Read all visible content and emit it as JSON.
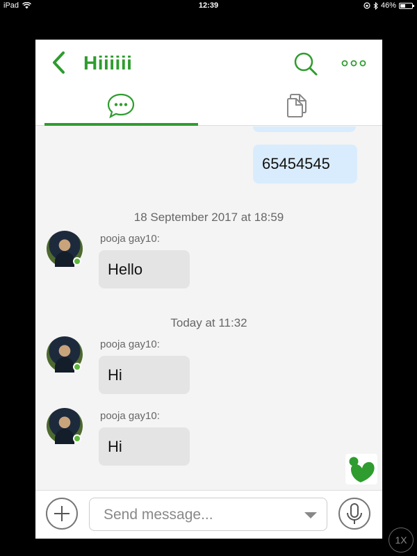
{
  "status_bar": {
    "device": "iPad",
    "time": "12:39",
    "battery": "46%",
    "battery_level": 0.46
  },
  "header": {
    "title": "Hiiiiii"
  },
  "tabs": [
    {
      "icon": "chat-bubble-icon",
      "active": true
    },
    {
      "icon": "copy-icon",
      "active": false
    }
  ],
  "messages": {
    "outgoing": [
      {
        "text": ""
      },
      {
        "text": "65454545"
      }
    ],
    "separators": [
      {
        "text": "18 September 2017 at 18:59"
      },
      {
        "text": "Today at 11:32"
      }
    ],
    "incoming": [
      {
        "sender": "pooja gay10:",
        "text": "Hello"
      },
      {
        "sender": "pooja gay10:",
        "text": "Hi"
      },
      {
        "sender": "pooja gay10:",
        "text": "Hi"
      }
    ]
  },
  "composer": {
    "placeholder": "Send message..."
  },
  "zoom": {
    "label": "1X"
  },
  "colors": {
    "accent": "#2e9c2e",
    "outgoing_bubble": "#d9ecfd",
    "incoming_bubble": "#e4e4e4",
    "online": "#5db83a"
  }
}
